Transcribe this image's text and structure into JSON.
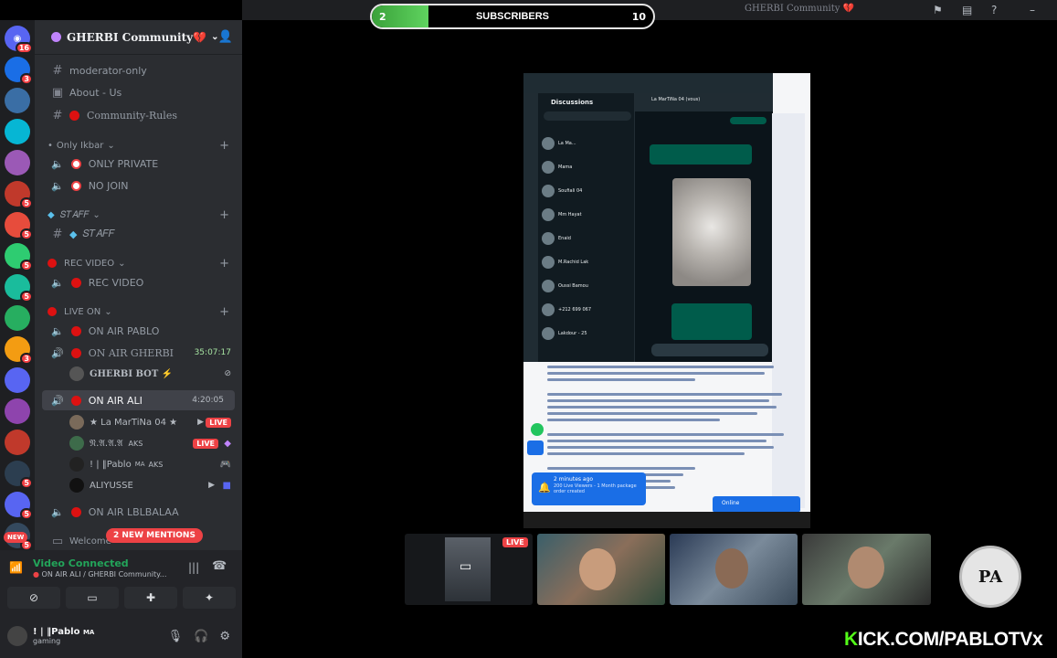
{
  "window": {
    "title": "GHERBI Community 💔"
  },
  "overlay": {
    "subscribers_label": "SUBSCRIBERS",
    "subscribers_current": "2",
    "subscribers_goal": "10",
    "subscribers_progress": 0.2,
    "brand_url": "ICK.COM/PABLOTVx",
    "brand_k": "K",
    "accent_color": "#53fc18",
    "logo_text": "PA"
  },
  "rail": {
    "badges": [
      "16",
      "3",
      "",
      "",
      "",
      "5",
      "5",
      "5",
      "5",
      "",
      "3",
      "",
      "",
      "",
      "5",
      "5",
      "5"
    ],
    "new_label": "NEW"
  },
  "server": {
    "name": "GHERBI Community💔"
  },
  "channels": {
    "moderator_only": "moderator-only",
    "about_us": "About - Us",
    "community_rules": "Community-Rules",
    "cat_only_ikbar": "Only Ikbar",
    "only_private": "ONLY PRIVATE",
    "no_join": "NO JOIN",
    "cat_staff": "𝑆𝑇𝐴𝐹𝐹",
    "staff": "𝑆𝑇𝐴𝐹𝐹",
    "cat_rec_video": "REC VIDEO",
    "rec_video": "REC VIDEO",
    "cat_live_on": "LIVE ON",
    "on_air_pablo": "ON AIR PABLO",
    "on_air_gherbi": "ON AIR GHERBI",
    "on_air_gherbi_time": "35:07:17",
    "gherbi_bot": "GHERBI BOT ⚡",
    "on_air_ali": "ON AIR ALI",
    "on_air_ali_time": "4:20:05",
    "user1": "★ La MarTiNa 04 ★",
    "user2": "𝔑.𝔄.𝔄.𝔄",
    "user2_tag": "AKS",
    "user3": "! | ‖Pablo",
    "user3_tag": "AKS",
    "user3_prefix": "MA",
    "user4": "ALIYUSSE",
    "on_air_lblbalaa": "ON AIR LBLBALAA",
    "welcome": "Welcome",
    "live_badge": "LIVE",
    "mentions": "2 NEW MENTIONS"
  },
  "voice": {
    "status": "Video Connected",
    "location": "ON AIR ALI / GHERBI Community..."
  },
  "me": {
    "name": "! | ‖Pablo",
    "tag": "MA",
    "status": "gaming"
  },
  "share": {
    "whatsapp_title": "Discussions",
    "chat_header": "La MarTiNa 04 (vous)",
    "chat_names": [
      "La Ma...",
      "Mama",
      "Soufiali 04",
      "Mm Hayat",
      "Enaid",
      "M.Rachid Lak",
      "Oussi Bamou",
      "+212 699 067",
      "Lakdour - 25"
    ],
    "notif_time": "2 minutes ago",
    "notif_text": "200 Live Viewers - 1 Month package order created",
    "chat_widget": "Online"
  },
  "cams": {
    "live_label": "LIVE"
  }
}
